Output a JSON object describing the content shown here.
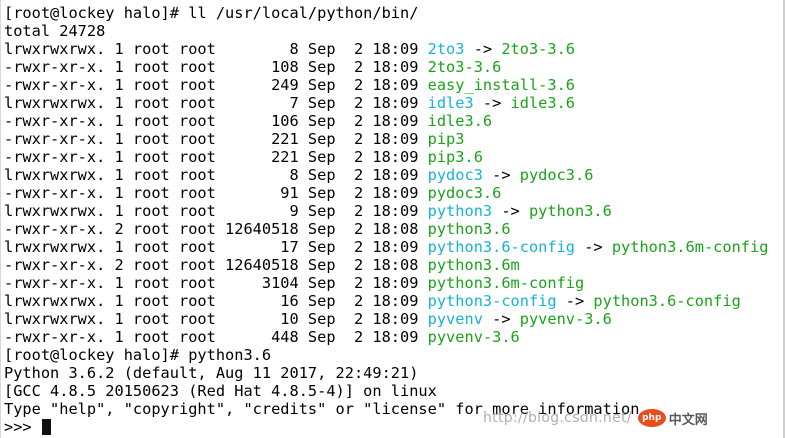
{
  "terminal": {
    "ls_prompt": "[root@lockey halo]# ",
    "ls_command": "ll /usr/local/python/bin/",
    "total_line": "total 24728",
    "entries": [
      {
        "meta": "lrwxrwxrwx. 1 root root        8 Sep  2 18:09 ",
        "name": "2to3",
        "name_color": "cyan",
        "arrow": " -> ",
        "target": "2to3-3.6"
      },
      {
        "meta": "-rwxr-xr-x. 1 root root      108 Sep  2 18:09 ",
        "name": "2to3-3.6",
        "name_color": "green",
        "arrow": "",
        "target": ""
      },
      {
        "meta": "-rwxr-xr-x. 1 root root      249 Sep  2 18:09 ",
        "name": "easy_install-3.6",
        "name_color": "green",
        "arrow": "",
        "target": ""
      },
      {
        "meta": "lrwxrwxrwx. 1 root root        7 Sep  2 18:09 ",
        "name": "idle3",
        "name_color": "cyan",
        "arrow": " -> ",
        "target": "idle3.6"
      },
      {
        "meta": "-rwxr-xr-x. 1 root root      106 Sep  2 18:09 ",
        "name": "idle3.6",
        "name_color": "green",
        "arrow": "",
        "target": ""
      },
      {
        "meta": "-rwxr-xr-x. 1 root root      221 Sep  2 18:09 ",
        "name": "pip3",
        "name_color": "green",
        "arrow": "",
        "target": ""
      },
      {
        "meta": "-rwxr-xr-x. 1 root root      221 Sep  2 18:09 ",
        "name": "pip3.6",
        "name_color": "green",
        "arrow": "",
        "target": ""
      },
      {
        "meta": "lrwxrwxrwx. 1 root root        8 Sep  2 18:09 ",
        "name": "pydoc3",
        "name_color": "cyan",
        "arrow": " -> ",
        "target": "pydoc3.6"
      },
      {
        "meta": "-rwxr-xr-x. 1 root root       91 Sep  2 18:09 ",
        "name": "pydoc3.6",
        "name_color": "green",
        "arrow": "",
        "target": ""
      },
      {
        "meta": "lrwxrwxrwx. 1 root root        9 Sep  2 18:09 ",
        "name": "python3",
        "name_color": "cyan",
        "arrow": " -> ",
        "target": "python3.6"
      },
      {
        "meta": "-rwxr-xr-x. 2 root root 12640518 Sep  2 18:08 ",
        "name": "python3.6",
        "name_color": "green",
        "arrow": "",
        "target": ""
      },
      {
        "meta": "lrwxrwxrwx. 1 root root       17 Sep  2 18:09 ",
        "name": "python3.6-config",
        "name_color": "cyan",
        "arrow": " -> ",
        "target": "python3.6m-config"
      },
      {
        "meta": "-rwxr-xr-x. 2 root root 12640518 Sep  2 18:08 ",
        "name": "python3.6m",
        "name_color": "green",
        "arrow": "",
        "target": ""
      },
      {
        "meta": "-rwxr-xr-x. 1 root root     3104 Sep  2 18:09 ",
        "name": "python3.6m-config",
        "name_color": "green",
        "arrow": "",
        "target": ""
      },
      {
        "meta": "lrwxrwxrwx. 1 root root       16 Sep  2 18:09 ",
        "name": "python3-config",
        "name_color": "cyan",
        "arrow": " -> ",
        "target": "python3.6-config"
      },
      {
        "meta": "lrwxrwxrwx. 1 root root       10 Sep  2 18:09 ",
        "name": "pyvenv",
        "name_color": "cyan",
        "arrow": " -> ",
        "target": "pyvenv-3.6"
      },
      {
        "meta": "-rwxr-xr-x. 1 root root      448 Sep  2 18:09 ",
        "name": "pyvenv-3.6",
        "name_color": "green",
        "arrow": "",
        "target": ""
      }
    ],
    "py_prompt": "[root@lockey halo]# ",
    "py_command": "python3.6",
    "py_banner": [
      "Python 3.6.2 (default, Aug 11 2017, 22:49:21)",
      "[GCC 4.8.5 20150623 (Red Hat 4.8.5-4)] on linux",
      "Type \"help\", \"copyright\", \"credits\" or \"license\" for more information."
    ],
    "repl_prompt": ">>> "
  },
  "colors": {
    "cyan": "#17b3d6",
    "green": "#1ba31b",
    "text": "#000000",
    "background": "#ffffff"
  },
  "watermark": {
    "url": "http://blog.csdn.net/",
    "logo_badge": "php",
    "logo_text": "中文网"
  }
}
